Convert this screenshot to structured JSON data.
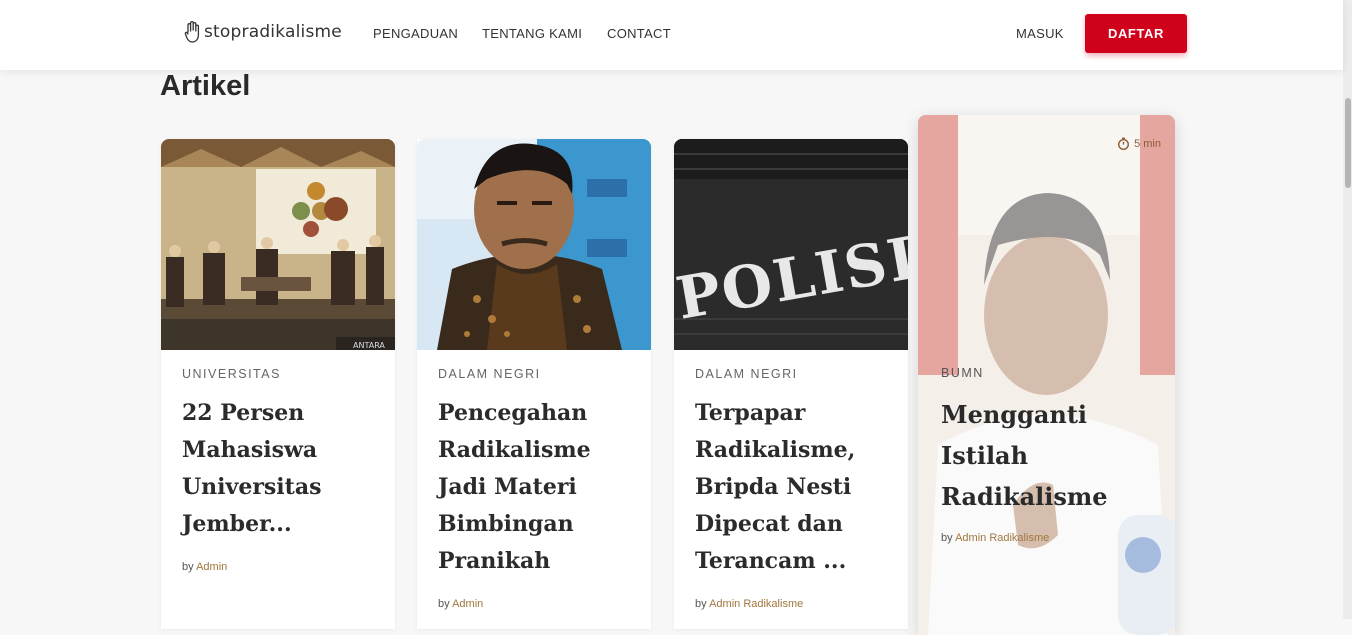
{
  "nav": {
    "logo_text": "stopradikalisme",
    "links": [
      "PENGADUAN",
      "TENTANG KAMI",
      "CONTACT"
    ],
    "login_label": "MASUK",
    "register_label": "DAFTAR"
  },
  "section": {
    "title": "Artikel"
  },
  "articles": [
    {
      "category": "UNIVERSITAS",
      "title": "22 Persen Mahasiswa Universitas Jember...",
      "author_prefix": "by",
      "author": "Admin"
    },
    {
      "category": "DALAM NEGRI",
      "title": "Pencegahan Radikalisme Jadi Materi Bimbingan Pranikah",
      "author_prefix": "by",
      "author": "Admin"
    },
    {
      "category": "DALAM NEGRI",
      "title": "Terpapar Radikalisme, Bripda Nesti Dipecat dan Terancam ...",
      "author_prefix": "by",
      "author": "Admin Radikalisme"
    },
    {
      "category": "BUMN",
      "title": "Mengganti Istilah Radikalisme",
      "author_prefix": "by",
      "author": "Admin Radikalisme",
      "read_time": "5 min"
    }
  ],
  "images": {
    "img1_watermark": "ANTARA",
    "img3_text": "POLISI"
  },
  "colors": {
    "accent": "#d0021b",
    "author_link": "#a0763e"
  }
}
